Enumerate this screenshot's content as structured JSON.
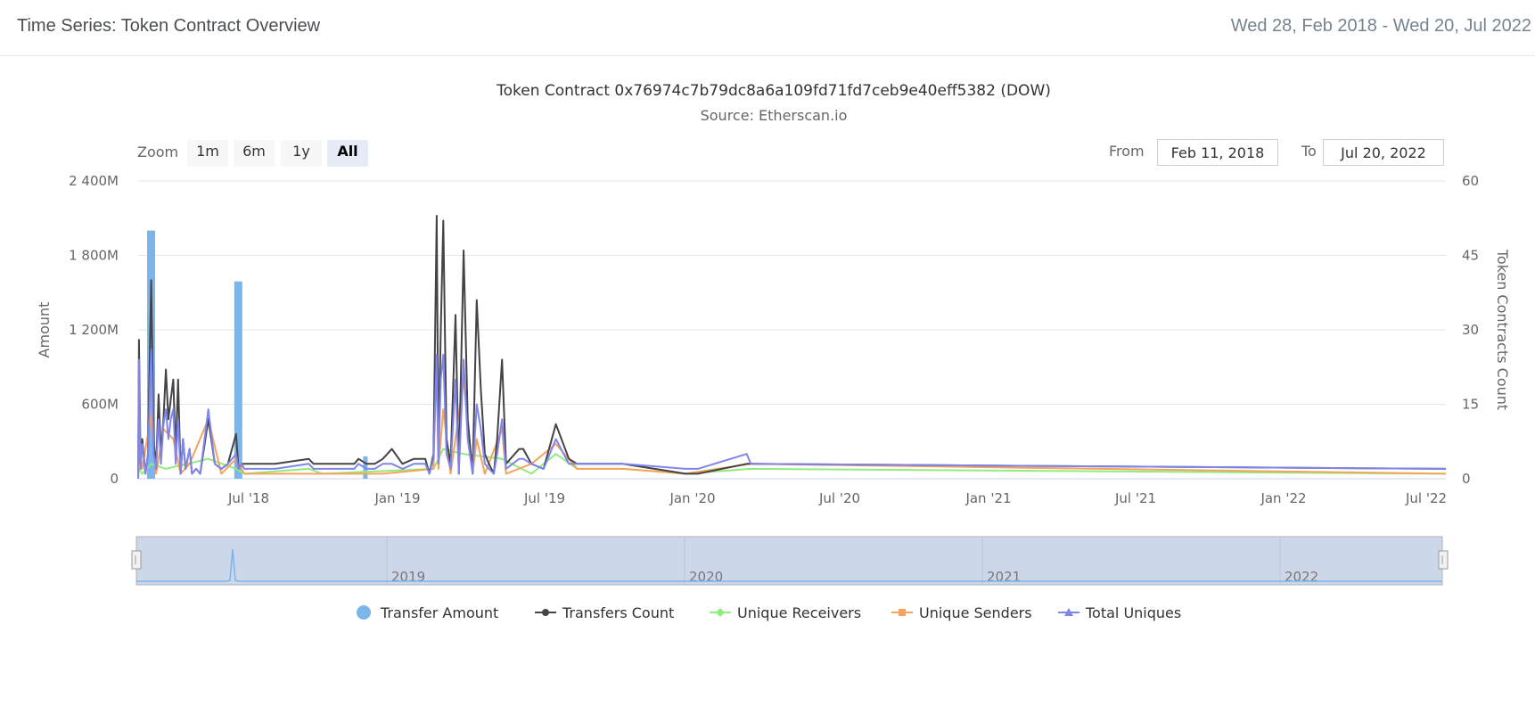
{
  "header": {
    "title": "Time Series: Token Contract Overview",
    "date_range": "Wed 28, Feb 2018 - Wed 20, Jul 2022"
  },
  "controls": {
    "zoom_label": "Zoom",
    "zoom_buttons": [
      "1m",
      "6m",
      "1y",
      "All"
    ],
    "selected_zoom": "All",
    "from_label": "From",
    "from_value": "Feb 11, 2018",
    "to_label": "To",
    "to_value": "Jul 20, 2022"
  },
  "colors": {
    "transfer_amount": "#7cb5ec",
    "transfers_count": "#434348",
    "unique_receivers": "#90ed7d",
    "unique_senders": "#f7a35c",
    "total_uniques": "#8085e9",
    "navigator_fill": "#cdd7ea"
  },
  "chart_data": {
    "type": "line",
    "title": "Token Contract 0x76974c7b79dc8a6a109fd71fd7ceb9e40eff5382 (DOW)",
    "subtitle": "Source: Etherscan.io",
    "x_ticks": [
      "Jul '18",
      "Jan '19",
      "Jul '19",
      "Jan '20",
      "Jul '20",
      "Jan '21",
      "Jul '21",
      "Jan '22",
      "Jul '22"
    ],
    "y_left": {
      "label": "Amount",
      "ticks": [
        "0",
        "600M",
        "1 200M",
        "1 800M",
        "2 400M"
      ],
      "range": [
        0,
        2400
      ]
    },
    "y_right": {
      "label": "Token Contracts Count",
      "ticks": [
        "0",
        "15",
        "30",
        "45",
        "60"
      ],
      "range": [
        0,
        60
      ]
    },
    "navigator_ticks": [
      "2019",
      "2020",
      "2021",
      "2022"
    ],
    "legend": [
      "Transfer Amount",
      "Transfers Count",
      "Unique Receivers",
      "Unique Senders",
      "Total Uniques"
    ],
    "transfer_amount_bars": [
      {
        "date": "2018-02-28",
        "value": 2000
      },
      {
        "date": "2018-02-28",
        "value": 2000
      },
      {
        "date": "2018-06-28",
        "value": 1590
      },
      {
        "date": "2018-06-28",
        "value": 1590
      },
      {
        "date": "2018-12-03",
        "value": 180
      }
    ],
    "series": [
      {
        "name": "Transfers Count",
        "points": [
          [
            "2018-02-28",
            0
          ],
          [
            "2018-03-01",
            28
          ],
          [
            "2018-03-03",
            3
          ],
          [
            "2018-03-05",
            8
          ],
          [
            "2018-03-09",
            1
          ],
          [
            "2018-03-12",
            5
          ],
          [
            "2018-03-16",
            40
          ],
          [
            "2018-03-19",
            8
          ],
          [
            "2018-03-22",
            2
          ],
          [
            "2018-03-25",
            17
          ],
          [
            "2018-03-28",
            5
          ],
          [
            "2018-03-31",
            12
          ],
          [
            "2018-04-03",
            22
          ],
          [
            "2018-04-06",
            12
          ],
          [
            "2018-04-09",
            16
          ],
          [
            "2018-04-12",
            20
          ],
          [
            "2018-04-15",
            5
          ],
          [
            "2018-04-18",
            20
          ],
          [
            "2018-04-21",
            1
          ],
          [
            "2018-04-24",
            8
          ],
          [
            "2018-04-27",
            2
          ],
          [
            "2018-05-02",
            6
          ],
          [
            "2018-05-05",
            1
          ],
          [
            "2018-05-10",
            2
          ],
          [
            "2018-05-15",
            1
          ],
          [
            "2018-05-25",
            12
          ],
          [
            "2018-06-02",
            3
          ],
          [
            "2018-06-10",
            2
          ],
          [
            "2018-06-18",
            3
          ],
          [
            "2018-06-28",
            9
          ],
          [
            "2018-07-01",
            2
          ],
          [
            "2018-07-05",
            3
          ],
          [
            "2018-07-08",
            3
          ],
          [
            "2018-08-15",
            3
          ],
          [
            "2018-09-25",
            4
          ],
          [
            "2018-10-01",
            3
          ],
          [
            "2018-10-12",
            3
          ],
          [
            "2018-11-20",
            3
          ],
          [
            "2018-11-25",
            4
          ],
          [
            "2018-12-05",
            3
          ],
          [
            "2018-12-15",
            3
          ],
          [
            "2018-12-25",
            4
          ],
          [
            "2019-01-05",
            6
          ],
          [
            "2019-01-18",
            3
          ],
          [
            "2019-02-01",
            4
          ],
          [
            "2019-02-15",
            4
          ],
          [
            "2019-02-20",
            1
          ],
          [
            "2019-02-25",
            5
          ],
          [
            "2019-03-01",
            53
          ],
          [
            "2019-03-03",
            5
          ],
          [
            "2019-03-06",
            30
          ],
          [
            "2019-03-09",
            52
          ],
          [
            "2019-03-13",
            8
          ],
          [
            "2019-03-18",
            3
          ],
          [
            "2019-03-24",
            33
          ],
          [
            "2019-03-28",
            1
          ],
          [
            "2019-04-03",
            46
          ],
          [
            "2019-04-08",
            12
          ],
          [
            "2019-04-14",
            1
          ],
          [
            "2019-04-19",
            36
          ],
          [
            "2019-04-24",
            18
          ],
          [
            "2019-04-29",
            5
          ],
          [
            "2019-05-04",
            3
          ],
          [
            "2019-05-10",
            1
          ],
          [
            "2019-05-14",
            8
          ],
          [
            "2019-05-20",
            24
          ],
          [
            "2019-05-25",
            3
          ],
          [
            "2019-06-10",
            6
          ],
          [
            "2019-06-15",
            6
          ],
          [
            "2019-06-25",
            3
          ],
          [
            "2019-07-10",
            2
          ],
          [
            "2019-07-25",
            11
          ],
          [
            "2019-08-10",
            4
          ],
          [
            "2019-08-20",
            3
          ],
          [
            "2019-10-15",
            3
          ],
          [
            "2019-12-31",
            1
          ],
          [
            "2020-01-15",
            1
          ],
          [
            "2020-03-15",
            3
          ],
          [
            "2020-03-20",
            3
          ],
          [
            "2022-07-20",
            2
          ]
        ]
      },
      {
        "name": "Unique Receivers",
        "points": [
          [
            "2018-02-28",
            0
          ],
          [
            "2018-03-01",
            2
          ],
          [
            "2018-03-05",
            1
          ],
          [
            "2018-03-16",
            3
          ],
          [
            "2018-04-03",
            2
          ],
          [
            "2018-05-25",
            4
          ],
          [
            "2018-06-28",
            2
          ],
          [
            "2018-07-08",
            1
          ],
          [
            "2018-09-25",
            2
          ],
          [
            "2018-10-12",
            1
          ],
          [
            "2019-02-25",
            2
          ],
          [
            "2019-03-09",
            6
          ],
          [
            "2019-04-03",
            5
          ],
          [
            "2019-05-20",
            4
          ],
          [
            "2019-06-25",
            1
          ],
          [
            "2019-07-25",
            5
          ],
          [
            "2019-08-20",
            2
          ],
          [
            "2019-10-15",
            2
          ],
          [
            "2019-12-31",
            1
          ],
          [
            "2020-03-20",
            2
          ],
          [
            "2022-07-20",
            1
          ]
        ]
      },
      {
        "name": "Unique Senders",
        "points": [
          [
            "2018-02-28",
            0
          ],
          [
            "2018-03-01",
            6
          ],
          [
            "2018-03-05",
            2
          ],
          [
            "2018-03-16",
            13
          ],
          [
            "2018-03-22",
            1
          ],
          [
            "2018-03-31",
            10
          ],
          [
            "2018-04-12",
            8
          ],
          [
            "2018-04-21",
            1
          ],
          [
            "2018-05-02",
            3
          ],
          [
            "2018-05-25",
            12
          ],
          [
            "2018-06-10",
            1
          ],
          [
            "2018-06-28",
            4
          ],
          [
            "2018-07-08",
            1
          ],
          [
            "2018-09-25",
            1
          ],
          [
            "2018-10-12",
            1
          ],
          [
            "2018-12-25",
            1
          ],
          [
            "2019-02-25",
            2
          ],
          [
            "2019-03-01",
            25
          ],
          [
            "2019-03-03",
            2
          ],
          [
            "2019-03-09",
            14
          ],
          [
            "2019-03-18",
            1
          ],
          [
            "2019-04-03",
            20
          ],
          [
            "2019-04-14",
            1
          ],
          [
            "2019-04-19",
            8
          ],
          [
            "2019-04-29",
            1
          ],
          [
            "2019-05-20",
            10
          ],
          [
            "2019-05-25",
            1
          ],
          [
            "2019-06-25",
            3
          ],
          [
            "2019-07-25",
            7
          ],
          [
            "2019-08-20",
            2
          ],
          [
            "2019-10-15",
            2
          ],
          [
            "2019-12-31",
            1
          ],
          [
            "2020-03-20",
            3
          ],
          [
            "2022-07-20",
            1
          ]
        ]
      },
      {
        "name": "Total Uniques",
        "points": [
          [
            "2018-02-28",
            0
          ],
          [
            "2018-03-01",
            24
          ],
          [
            "2018-03-03",
            2
          ],
          [
            "2018-03-05",
            7
          ],
          [
            "2018-03-09",
            1
          ],
          [
            "2018-03-12",
            5
          ],
          [
            "2018-03-16",
            26
          ],
          [
            "2018-03-19",
            5
          ],
          [
            "2018-03-22",
            2
          ],
          [
            "2018-03-25",
            12
          ],
          [
            "2018-03-28",
            3
          ],
          [
            "2018-03-31",
            11
          ],
          [
            "2018-04-03",
            14
          ],
          [
            "2018-04-06",
            8
          ],
          [
            "2018-04-09",
            12
          ],
          [
            "2018-04-12",
            14
          ],
          [
            "2018-04-15",
            3
          ],
          [
            "2018-04-18",
            12
          ],
          [
            "2018-04-21",
            1
          ],
          [
            "2018-04-24",
            8
          ],
          [
            "2018-04-27",
            2
          ],
          [
            "2018-05-02",
            6
          ],
          [
            "2018-05-05",
            1
          ],
          [
            "2018-05-10",
            2
          ],
          [
            "2018-05-15",
            1
          ],
          [
            "2018-05-25",
            14
          ],
          [
            "2018-06-02",
            3
          ],
          [
            "2018-06-10",
            2
          ],
          [
            "2018-06-18",
            3
          ],
          [
            "2018-06-28",
            5
          ],
          [
            "2018-07-01",
            2
          ],
          [
            "2018-07-05",
            3
          ],
          [
            "2018-07-08",
            2
          ],
          [
            "2018-08-15",
            2
          ],
          [
            "2018-09-25",
            3
          ],
          [
            "2018-10-01",
            2
          ],
          [
            "2018-10-12",
            2
          ],
          [
            "2018-11-20",
            2
          ],
          [
            "2018-11-25",
            3
          ],
          [
            "2018-12-05",
            2
          ],
          [
            "2018-12-15",
            2
          ],
          [
            "2018-12-25",
            3
          ],
          [
            "2019-01-05",
            3
          ],
          [
            "2019-01-18",
            2
          ],
          [
            "2019-02-01",
            3
          ],
          [
            "2019-02-15",
            3
          ],
          [
            "2019-02-20",
            1
          ],
          [
            "2019-02-25",
            4
          ],
          [
            "2019-03-01",
            25
          ],
          [
            "2019-03-03",
            3
          ],
          [
            "2019-03-06",
            20
          ],
          [
            "2019-03-09",
            25
          ],
          [
            "2019-03-13",
            5
          ],
          [
            "2019-03-18",
            2
          ],
          [
            "2019-03-24",
            20
          ],
          [
            "2019-03-28",
            1
          ],
          [
            "2019-04-03",
            24
          ],
          [
            "2019-04-08",
            8
          ],
          [
            "2019-04-14",
            1
          ],
          [
            "2019-04-19",
            15
          ],
          [
            "2019-04-24",
            10
          ],
          [
            "2019-04-29",
            3
          ],
          [
            "2019-05-04",
            2
          ],
          [
            "2019-05-10",
            1
          ],
          [
            "2019-05-14",
            5
          ],
          [
            "2019-05-20",
            12
          ],
          [
            "2019-05-25",
            2
          ],
          [
            "2019-06-10",
            4
          ],
          [
            "2019-06-15",
            4
          ],
          [
            "2019-06-25",
            3
          ],
          [
            "2019-07-10",
            2
          ],
          [
            "2019-07-25",
            8
          ],
          [
            "2019-08-10",
            3
          ],
          [
            "2019-08-20",
            3
          ],
          [
            "2019-10-15",
            3
          ],
          [
            "2019-12-31",
            2
          ],
          [
            "2020-01-15",
            2
          ],
          [
            "2020-03-15",
            5
          ],
          [
            "2020-03-20",
            3
          ],
          [
            "2022-07-20",
            2
          ]
        ]
      }
    ]
  }
}
